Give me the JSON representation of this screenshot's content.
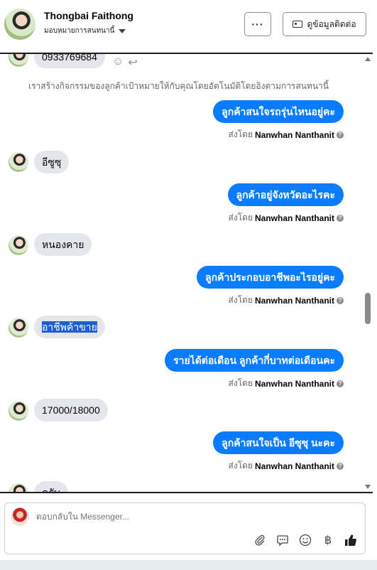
{
  "header": {
    "contact_name": "Thongbai Faithong",
    "assign_label": "มอบหมายการสนทนานี้",
    "more_label": "···",
    "info_button_label": "ดูข้อมูลติดต่อ"
  },
  "conversation": {
    "first_message": "0933769684",
    "system_note": "เราสร้างกิจกรรมของลูกค้าเป้าหมายให้กับคุณโดยอัตโนมัติโดยอิงตามการสนทนานี้",
    "sent_by_prefix": "ส่งโดย",
    "agent_name": "Nanwhan Nanthanit",
    "messages": [
      {
        "dir": "out",
        "text": "ลูกค้าสนใจรถรุ่นไหนอยู่คะ"
      },
      {
        "dir": "in",
        "text": "อีซูซุ"
      },
      {
        "dir": "out",
        "text": "ลูกค้าอยู่จังหวัดอะไรคะ"
      },
      {
        "dir": "in",
        "text": "หนองคาย"
      },
      {
        "dir": "out",
        "text": "ลูกค้าประกอบอาชีพอะไรอยู่คะ"
      },
      {
        "dir": "in",
        "text": "อาชีพค้าขาย"
      },
      {
        "dir": "out",
        "text": "รายได้ต่อเดือน ลูกค้ากี่บาทต่อเดือนคะ"
      },
      {
        "dir": "in",
        "text": "17000/18000"
      },
      {
        "dir": "out",
        "text": "ลูกค้าสนใจเป็น อีซุซุ นะคะ"
      }
    ],
    "partial_last": "ครับ"
  },
  "composer": {
    "placeholder": "ตอบกลับใน Messenger...",
    "icons": [
      "attachment-icon",
      "saved-reply-icon",
      "emoji-icon",
      "baht-icon",
      "like-icon"
    ]
  }
}
